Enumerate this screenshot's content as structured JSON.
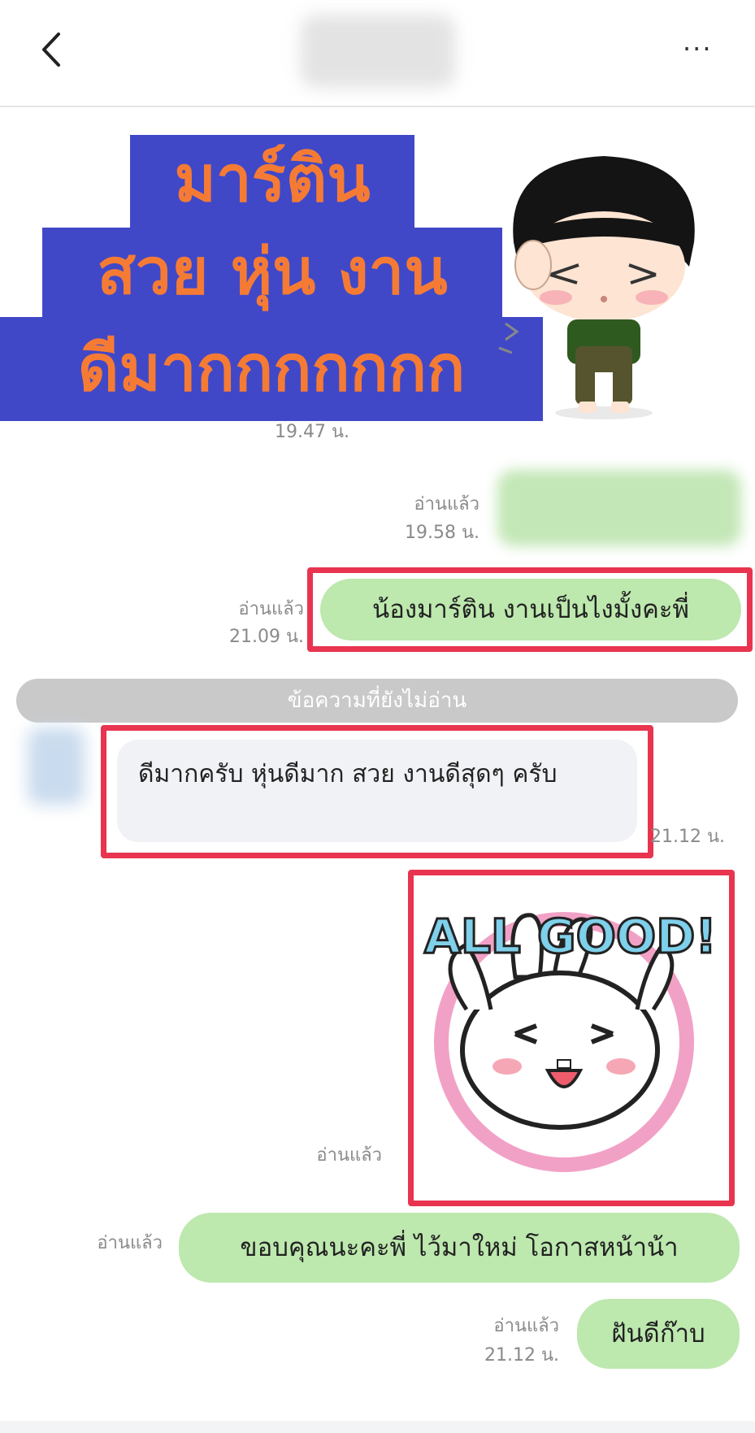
{
  "header": {
    "back_icon": "chevron-left-icon",
    "more_icon": "more-horizontal-icon",
    "more_label": "···"
  },
  "banner": {
    "line1": "มาร์ติน",
    "line2": "สวย หุ่น งาน",
    "line3": "ดีมากกกกกกก",
    "text_color": "#f57b35",
    "band_color": "#4048c8"
  },
  "messages": [
    {
      "time": "19.47 น."
    },
    {
      "read": "อ่านแล้ว",
      "time": "19.58 น."
    },
    {
      "read": "อ่านแล้ว",
      "time": "21.09 น.",
      "text": "น้องมาร์ติน งานเป็นไงมั้งคะพี่"
    },
    {
      "text": "ดีมากครับ หุ่นดีมาก สวย งานดีสุดๆ ครับ",
      "time": "21.12 น."
    },
    {
      "read": "อ่านแล้ว",
      "sticker_text": "ALL GOOD!"
    },
    {
      "read": "อ่านแล้ว",
      "text": "ขอบคุณนะคะพี่ ไว้มาใหม่ โอกาสหน้าน้า"
    },
    {
      "read": "อ่านแล้ว",
      "time": "21.12 น.",
      "text": "ฝันดีก๊าบ"
    }
  ],
  "unread_divider": "ข้อความที่ยังไม่อ่าน",
  "colors": {
    "sent_bubble": "#bde8ae",
    "received_bubble": "#f1f2f5",
    "highlight": "#e8344f"
  }
}
